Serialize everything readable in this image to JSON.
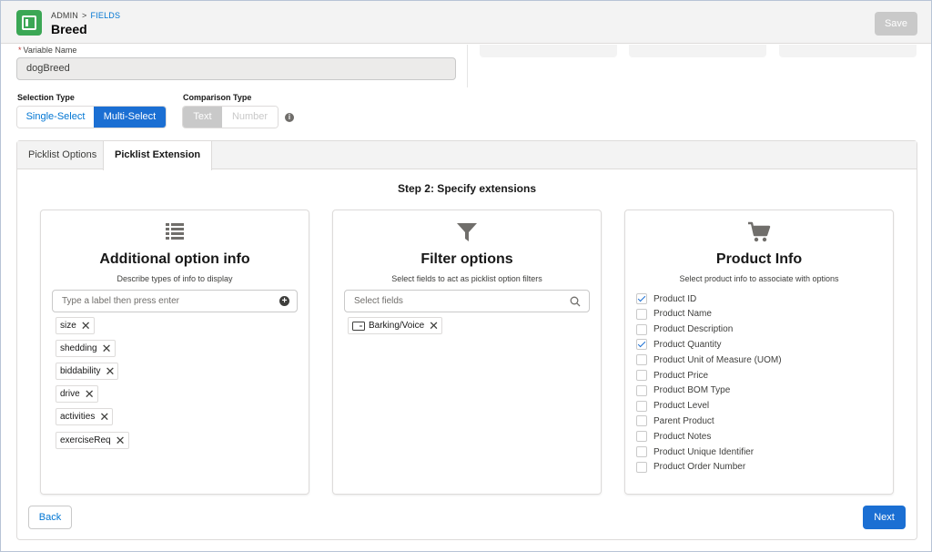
{
  "header": {
    "breadcrumb_root": "ADMIN",
    "breadcrumb_sep": ">",
    "breadcrumb_link": "FIELDS",
    "title": "Breed",
    "save_label": "Save"
  },
  "variable": {
    "label": "Variable Name",
    "required_mark": "*",
    "value": "dogBreed"
  },
  "selection_type": {
    "label": "Selection Type",
    "options": [
      "Single-Select",
      "Multi-Select"
    ],
    "selected": "Multi-Select"
  },
  "comparison_type": {
    "label": "Comparison Type",
    "options": [
      "Text",
      "Number"
    ],
    "selected": "Text"
  },
  "info_icon": "i",
  "tabs": [
    {
      "label": "Picklist Options",
      "active": false
    },
    {
      "label": "Picklist Extension",
      "active": true
    }
  ],
  "step_title": "Step 2: Specify extensions",
  "panels": {
    "additional": {
      "icon": "table-list-icon",
      "title": "Additional option info",
      "subtitle": "Describe types of info to display",
      "input_placeholder": "Type a label then press enter",
      "pills": [
        "size",
        "shedding",
        "biddability",
        "drive",
        "activities",
        "exerciseReq"
      ]
    },
    "filter": {
      "icon": "filter-icon",
      "title": "Filter options",
      "subtitle": "Select fields to act as picklist option filters",
      "input_placeholder": "Select fields",
      "pills": [
        "Barking/Voice"
      ]
    },
    "product": {
      "icon": "cart-icon",
      "title": "Product Info",
      "subtitle": "Select product info to associate with options",
      "items": [
        {
          "label": "Product ID",
          "checked": true
        },
        {
          "label": "Product Name",
          "checked": false
        },
        {
          "label": "Product Description",
          "checked": false
        },
        {
          "label": "Product Quantity",
          "checked": true
        },
        {
          "label": "Product Unit of Measure (UOM)",
          "checked": false
        },
        {
          "label": "Product Price",
          "checked": false
        },
        {
          "label": "Product BOM Type",
          "checked": false
        },
        {
          "label": "Product Level",
          "checked": false
        },
        {
          "label": "Parent Product",
          "checked": false
        },
        {
          "label": "Product Notes",
          "checked": false
        },
        {
          "label": "Product Unique Identifier",
          "checked": false
        },
        {
          "label": "Product Order Number",
          "checked": false
        }
      ]
    }
  },
  "footer": {
    "back_label": "Back",
    "next_label": "Next"
  },
  "colors": {
    "brand_green": "#3ba755",
    "primary_blue": "#1b6fd3",
    "link_blue": "#0176d3"
  }
}
